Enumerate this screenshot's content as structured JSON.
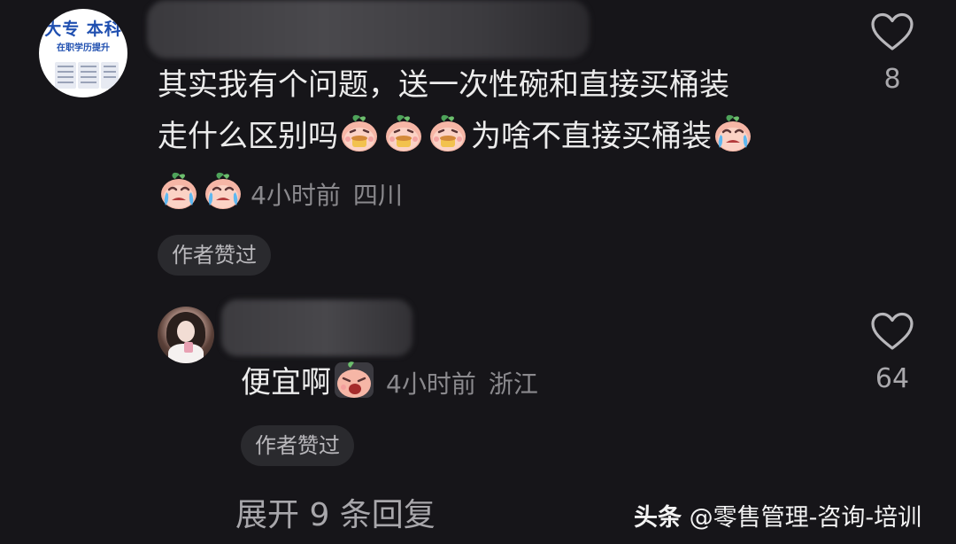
{
  "comment1": {
    "avatar": {
      "title": "大专  本科",
      "subtitle": "在职学历提升"
    },
    "text_line1": "其实我有个问题，送一次性碗和直接买桶装",
    "text_line2_a": "走什么区别吗",
    "text_line2_b": "为啥不直接买桶装",
    "time": "4小时前",
    "location": "四川",
    "liked_label": "作者赞过",
    "like_count": "8"
  },
  "reply1": {
    "text": "便宜啊",
    "time": "4小时前",
    "location": "浙江",
    "liked_label": "作者赞过",
    "like_count": "64"
  },
  "expand_label": "展开 9 条回复",
  "watermark": {
    "source": "头条",
    "account": "@零售管理-咨询-培训"
  },
  "icons": {
    "heart": "heart-outline-icon",
    "emoji_eating": "peach-eating-emoji",
    "emoji_crying": "peach-crying-emoji"
  }
}
